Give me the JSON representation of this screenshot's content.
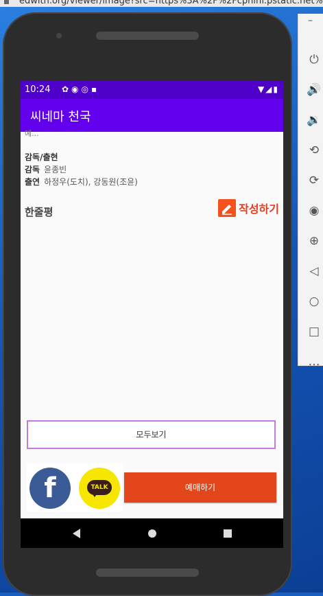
{
  "browser": {
    "url": "edwith.org/viewer/image?src=https%3A%2F%2Fcphinf.pstatic.net%2F"
  },
  "status_bar": {
    "time": "10:24"
  },
  "app_bar": {
    "title": "씨네마 천국"
  },
  "detail": {
    "cut_text": "예...",
    "section_title": "감독/출현",
    "director_label": "감독",
    "director_value": "윤종빈",
    "cast_label": "출연",
    "cast_value": "하정우(도치), 강동원(조윤)"
  },
  "review": {
    "title": "한줄평",
    "write_label": "작성하기"
  },
  "buttons": {
    "see_all": "모두보기",
    "reserve": "예매하기"
  },
  "share": {
    "facebook_glyph": "f",
    "kakao_glyph": "TALK"
  },
  "colors": {
    "status_bar": "#4f00c9",
    "app_bar": "#6200ee",
    "accent": "#e4461b",
    "see_all_border": "#c57bdc"
  },
  "icons": [
    "settings-icon",
    "shield-icon",
    "vpn-icon",
    "sd-card-icon",
    "wifi-icon",
    "signal-icon",
    "battery-icon",
    "power-icon",
    "volume-up-icon",
    "volume-down-icon",
    "rotate-left-icon",
    "rotate-right-icon",
    "camera-icon",
    "zoom-icon",
    "back-icon",
    "home-icon",
    "overview-icon",
    "more-icon"
  ]
}
